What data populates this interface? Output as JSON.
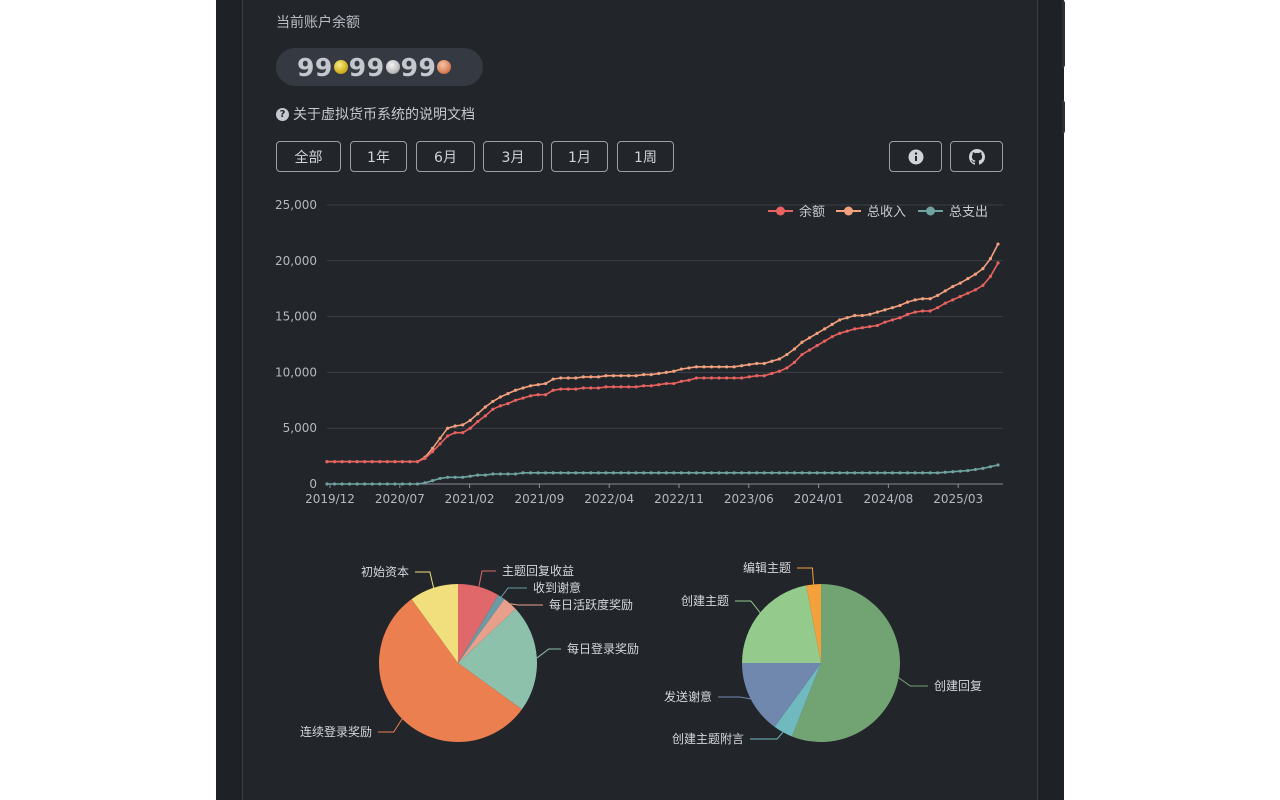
{
  "balance": {
    "label": "当前账户余额",
    "gold": "99",
    "silver": "99",
    "bronze": "99"
  },
  "doc_link": "关于虚拟货币系统的说明文档",
  "ranges": [
    "全部",
    "1年",
    "6月",
    "3月",
    "1月",
    "1周"
  ],
  "icons": [
    "info-icon",
    "github-icon"
  ],
  "chart_data": [
    {
      "type": "line",
      "x": [
        "2019/12",
        "2020/07",
        "2021/02",
        "2021/09",
        "2022/04",
        "2022/11",
        "2023/06",
        "2024/01",
        "2024/08",
        "2025/03"
      ],
      "ylim": [
        0,
        25000
      ],
      "yticks": [
        0,
        5000,
        10000,
        15000,
        20000,
        25000
      ],
      "ytick_labels": [
        "0",
        "5,000",
        "10,000",
        "15,000",
        "20,000",
        "25,000"
      ],
      "grid": true,
      "legend": "top-right",
      "series": [
        {
          "name": "余额",
          "color": "#e8625f",
          "values": [
            2000,
            2000,
            2000,
            2000,
            2000,
            2000,
            2000,
            2000,
            2000,
            2000,
            2000,
            2000,
            2000,
            2300,
            2900,
            3600,
            4300,
            4600,
            4600,
            5000,
            5600,
            6100,
            6700,
            7000,
            7200,
            7500,
            7700,
            7900,
            8000,
            8000,
            8400,
            8500,
            8500,
            8500,
            8600,
            8600,
            8600,
            8700,
            8700,
            8700,
            8700,
            8700,
            8800,
            8800,
            8900,
            9000,
            9000,
            9200,
            9300,
            9500,
            9500,
            9500,
            9500,
            9500,
            9500,
            9500,
            9600,
            9700,
            9700,
            9900,
            10100,
            10400,
            10900,
            11600,
            12000,
            12400,
            12800,
            13200,
            13500,
            13700,
            13900,
            14000,
            14100,
            14200,
            14500,
            14700,
            14900,
            15200,
            15400,
            15500,
            15500,
            15800,
            16200,
            16500,
            16800,
            17100,
            17400,
            17800,
            18600,
            19800
          ]
        },
        {
          "name": "总收入",
          "color": "#f2a07e",
          "values": [
            2000,
            2000,
            2000,
            2000,
            2000,
            2000,
            2000,
            2000,
            2000,
            2000,
            2000,
            2000,
            2000,
            2400,
            3200,
            4100,
            5000,
            5200,
            5300,
            5700,
            6300,
            6900,
            7400,
            7800,
            8100,
            8400,
            8600,
            8800,
            8900,
            9000,
            9400,
            9500,
            9500,
            9500,
            9600,
            9600,
            9600,
            9700,
            9700,
            9700,
            9700,
            9700,
            9800,
            9800,
            9900,
            10000,
            10100,
            10300,
            10400,
            10500,
            10500,
            10500,
            10500,
            10500,
            10500,
            10600,
            10700,
            10800,
            10800,
            11000,
            11200,
            11600,
            12100,
            12700,
            13100,
            13500,
            13900,
            14300,
            14700,
            14900,
            15100,
            15100,
            15200,
            15400,
            15600,
            15800,
            16000,
            16300,
            16500,
            16600,
            16600,
            16900,
            17300,
            17700,
            18000,
            18400,
            18800,
            19300,
            20200,
            21500
          ]
        },
        {
          "name": "总支出",
          "color": "#6fa3a2",
          "values": [
            0,
            0,
            0,
            0,
            0,
            0,
            0,
            0,
            0,
            0,
            0,
            0,
            0,
            100,
            300,
            500,
            600,
            600,
            600,
            700,
            800,
            800,
            900,
            900,
            900,
            900,
            1000,
            1000,
            1000,
            1000,
            1000,
            1000,
            1000,
            1000,
            1000,
            1000,
            1000,
            1000,
            1000,
            1000,
            1000,
            1000,
            1000,
            1000,
            1000,
            1000,
            1000,
            1000,
            1000,
            1000,
            1000,
            1000,
            1000,
            1000,
            1000,
            1000,
            1000,
            1000,
            1000,
            1000,
            1000,
            1000,
            1000,
            1000,
            1000,
            1000,
            1000,
            1000,
            1000,
            1000,
            1000,
            1000,
            1000,
            1000,
            1000,
            1000,
            1000,
            1000,
            1000,
            1000,
            1000,
            1000,
            1050,
            1100,
            1150,
            1200,
            1300,
            1400,
            1550,
            1700
          ]
        }
      ]
    },
    {
      "type": "pie",
      "slices": [
        {
          "label": "主题回复收益",
          "value": 8.5,
          "color": "#e0676a"
        },
        {
          "label": "收到谢意",
          "value": 1.5,
          "color": "#6b9ba5"
        },
        {
          "label": "每日活跃度奖励",
          "value": 3,
          "color": "#e8a08c"
        },
        {
          "label": "每日登录奖励",
          "value": 22,
          "color": "#8ec1ab"
        },
        {
          "label": "连续登录奖励",
          "value": 55,
          "color": "#eb7f4f"
        },
        {
          "label": "初始资本",
          "value": 10,
          "color": "#f0df7c"
        }
      ]
    },
    {
      "type": "pie",
      "slices": [
        {
          "label": "创建回复",
          "value": 56,
          "color": "#72a473"
        },
        {
          "label": "创建主题附言",
          "value": 4,
          "color": "#70b9be"
        },
        {
          "label": "发送谢意",
          "value": 15,
          "color": "#7188ae"
        },
        {
          "label": "创建主题",
          "value": 22,
          "color": "#94cb8d"
        },
        {
          "label": "编辑主题",
          "value": 3,
          "color": "#f4a13b"
        }
      ]
    }
  ]
}
